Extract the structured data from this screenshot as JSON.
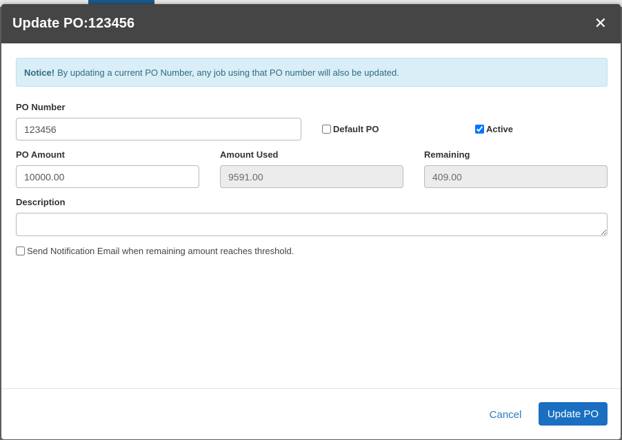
{
  "modal": {
    "title": "Update PO:123456",
    "close_symbol": "✕"
  },
  "notice": {
    "label": "Notice!",
    "text": "By updating a current PO Number, any job using that PO number will also be updated."
  },
  "form": {
    "po_number": {
      "label": "PO Number",
      "value": "123456"
    },
    "default_po": {
      "label": "Default PO",
      "checked": false
    },
    "active": {
      "label": "Active",
      "checked": true
    },
    "po_amount": {
      "label": "PO Amount",
      "value": "10000.00"
    },
    "amount_used": {
      "label": "Amount Used",
      "value": "9591.00"
    },
    "remaining": {
      "label": "Remaining",
      "value": "409.00"
    },
    "description": {
      "label": "Description",
      "value": ""
    },
    "notify": {
      "label": "Send Notification Email when remaining amount reaches threshold.",
      "checked": false
    }
  },
  "footer": {
    "cancel_label": "Cancel",
    "update_label": "Update PO"
  },
  "colors": {
    "header_bg": "#454545",
    "notice_bg": "#d9eef6",
    "primary": "#1a6fc0",
    "link": "#2f7ac0"
  }
}
